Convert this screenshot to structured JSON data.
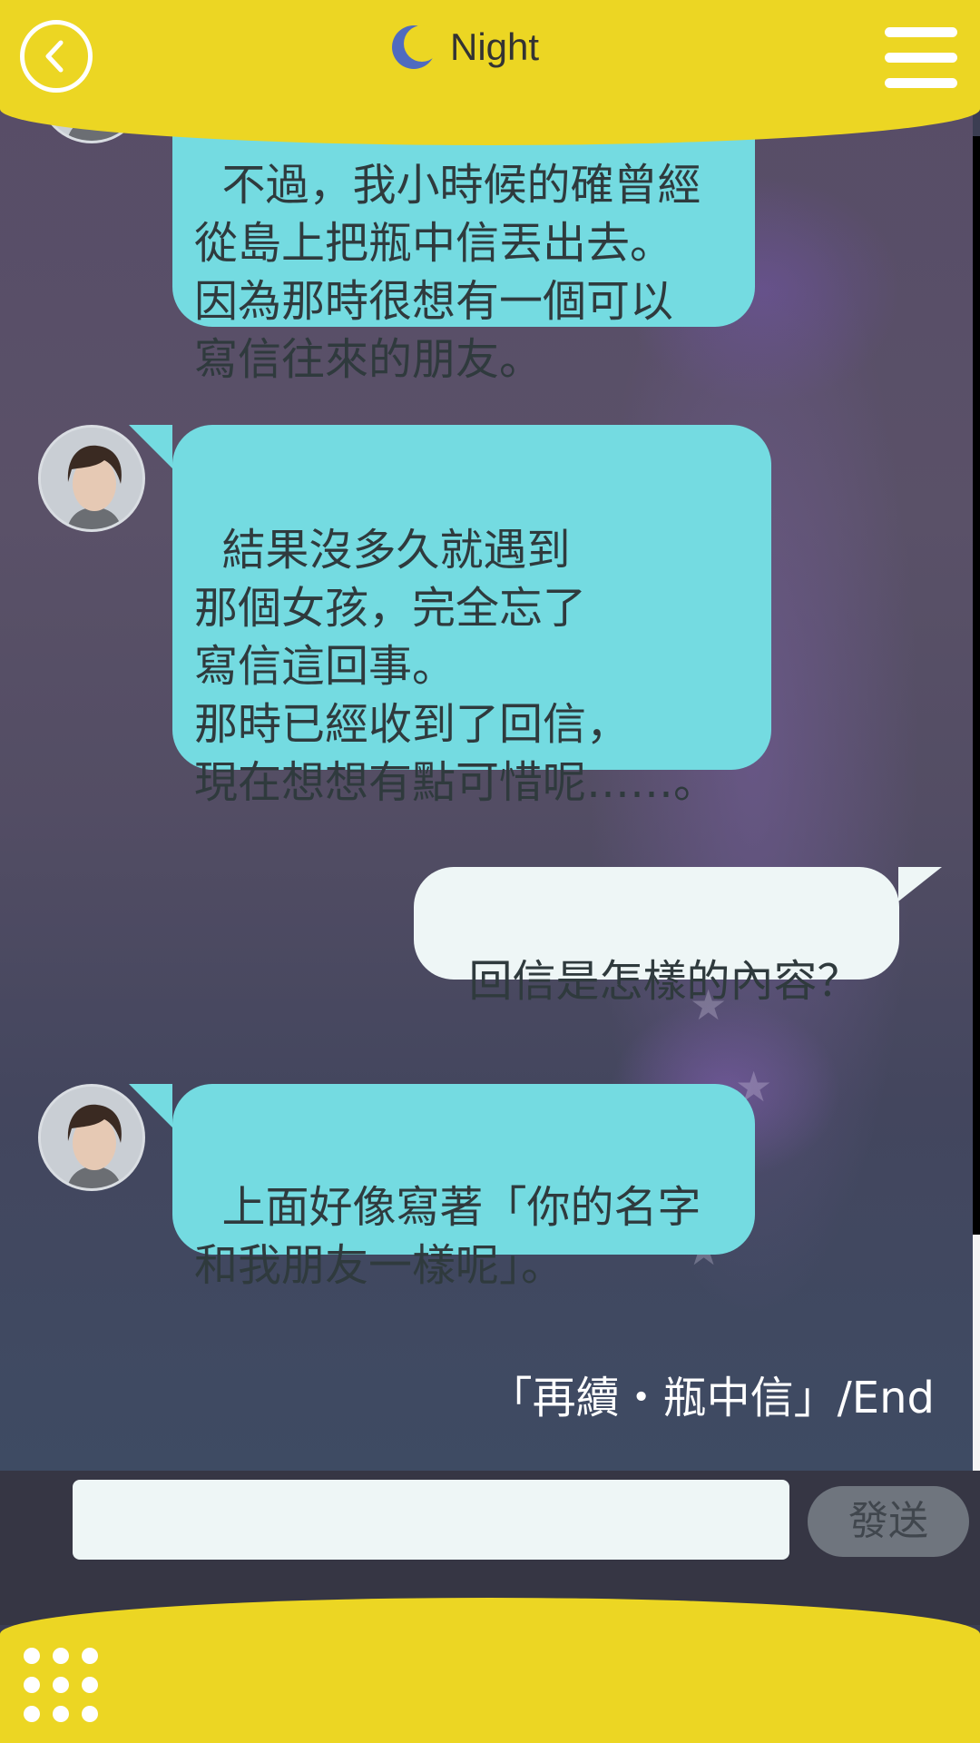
{
  "header": {
    "title": "Night",
    "back_icon": "back-arrow-icon",
    "menu_icon": "hamburger-menu-icon",
    "moon_icon": "moon-icon"
  },
  "messages": [
    {
      "side": "left",
      "text": "不過，我小時候的確曾經\n從島上把瓶中信丟出去。\n因為那時很想有一個可以\n寫信往來的朋友。"
    },
    {
      "side": "left",
      "text": "結果沒多久就遇到\n那個女孩，完全忘了\n寫信這回事。\n那時已經收到了回信，\n現在想想有點可惜呢……。"
    },
    {
      "side": "right",
      "text": "回信是怎樣的內容？"
    },
    {
      "side": "left",
      "text": "上面好像寫著「你的名字\n和我朋友一樣呢」。"
    }
  ],
  "end_label": "「再續・瓶中信」/End",
  "input": {
    "value": "",
    "placeholder": ""
  },
  "send_label": "發送",
  "footer": {
    "grid_icon": "grid-menu-icon"
  },
  "colors": {
    "header_yellow": "#ecd623",
    "bubble_left": "#74dbe1",
    "bubble_right": "#eef6f6",
    "input_bar": "#363644"
  }
}
